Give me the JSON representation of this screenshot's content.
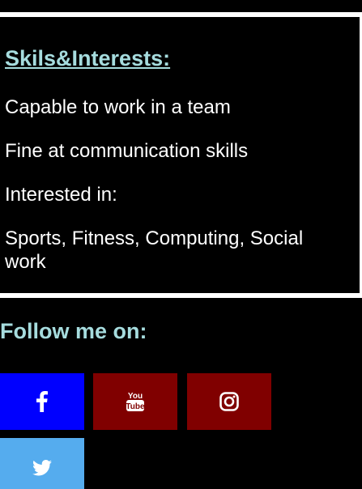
{
  "skills": {
    "heading": "Skils&Interests:",
    "lines": [
      "Capable to work in a team",
      "Fine at communication skills",
      "Interested in:",
      "Sports, Fitness, Computing, Social work"
    ]
  },
  "follow": {
    "heading": "Follow me on:",
    "buttons": [
      {
        "icon": "facebook-icon",
        "color": "#0000ff"
      },
      {
        "icon": "youtube-icon",
        "color": "#800000"
      },
      {
        "icon": "instagram-icon",
        "color": "#800000"
      },
      {
        "icon": "twitter-icon",
        "color": "#55acee"
      }
    ]
  },
  "colors": {
    "background": "#000000",
    "heading": "#a6dcde",
    "text": "#ffffff",
    "panel_border": "#ffffff"
  }
}
